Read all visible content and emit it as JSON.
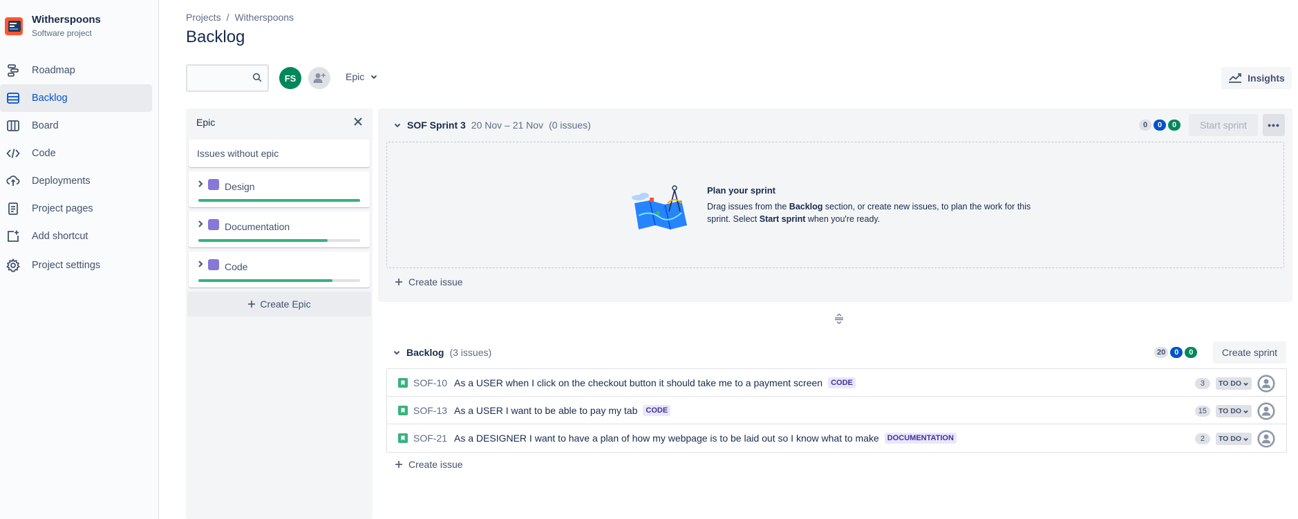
{
  "project": {
    "name": "Witherspoons",
    "type": "Software project"
  },
  "sidebar": {
    "items": [
      {
        "label": "Roadmap",
        "icon": "roadmap-icon"
      },
      {
        "label": "Backlog",
        "icon": "backlog-icon",
        "active": true
      },
      {
        "label": "Board",
        "icon": "board-icon"
      },
      {
        "label": "Code",
        "icon": "code-icon"
      },
      {
        "label": "Deployments",
        "icon": "deployments-icon"
      },
      {
        "label": "Project pages",
        "icon": "page-icon"
      },
      {
        "label": "Add shortcut",
        "icon": "add-shortcut-icon"
      },
      {
        "label": "Project settings",
        "icon": "gear-icon"
      }
    ]
  },
  "breadcrumb": {
    "projects": "Projects",
    "sep": "/",
    "project": "Witherspoons"
  },
  "page_title": "Backlog",
  "toolbar": {
    "search_value": "",
    "avatar_initials": "FS",
    "epic_filter": "Epic",
    "insights": "Insights"
  },
  "epic_panel": {
    "title": "Epic",
    "issues_without_epic": "Issues without epic",
    "epics": [
      {
        "name": "Design",
        "progress": 1.0
      },
      {
        "name": "Documentation",
        "progress": 0.8
      },
      {
        "name": "Code",
        "progress": 0.83
      }
    ],
    "create_epic": "Create Epic"
  },
  "sprint": {
    "name": "SOF Sprint 3",
    "dates": "20 Nov – 21 Nov",
    "issue_count": "(0 issues)",
    "counts": {
      "todo": "0",
      "in_progress": "0",
      "done": "0"
    },
    "start_sprint": "Start sprint",
    "more": "•••",
    "empty": {
      "title": "Plan your sprint",
      "desc_1": "Drag issues from the ",
      "desc_b1": "Backlog",
      "desc_2": " section, or create new issues, to plan the work for this sprint. Select ",
      "desc_b2": "Start sprint",
      "desc_3": " when you're ready."
    },
    "create_issue": "Create issue"
  },
  "backlog": {
    "name": "Backlog",
    "issue_count": "(3 issues)",
    "counts": {
      "todo": "20",
      "in_progress": "0",
      "done": "0"
    },
    "create_sprint": "Create sprint",
    "issues": [
      {
        "key": "SOF-10",
        "summary": "As a USER when I click on the checkout button it should take me to a payment screen",
        "epic": "CODE",
        "estimate": "3",
        "status": "TO DO"
      },
      {
        "key": "SOF-13",
        "summary": "As a USER I want to be able to pay my tab",
        "epic": "CODE",
        "estimate": "15",
        "status": "TO DO"
      },
      {
        "key": "SOF-21",
        "summary": "As a DESIGNER I want to have a plan of how my webpage is to be laid out so I know what to make",
        "epic": "DOCUMENTATION",
        "estimate": "2",
        "status": "TO DO"
      }
    ],
    "create_issue": "Create issue"
  },
  "colors": {
    "accent": "#0052cc",
    "story": "#36b37e",
    "epic": "#8777d9",
    "done": "#00875a"
  }
}
